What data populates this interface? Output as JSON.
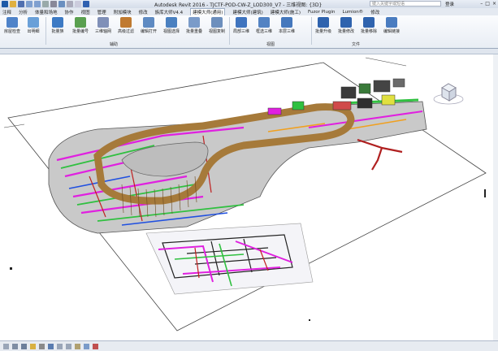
{
  "window": {
    "title": "Autodesk Revit 2016 -   TJCTF-POD-CW-Z_LOD300_V7 - 三维视图: {3D}",
    "search_placeholder": "键入关键字或短语",
    "login": "登录"
  },
  "tabs": [
    "注释",
    "分析",
    "体量和场地",
    "协作",
    "视图",
    "管理",
    "附加模块",
    "修改",
    "族库大师V4.4",
    "建模大师(通用)",
    "建模大师(建筑)",
    "建模大师(施工)",
    "Fuzor Plugin",
    "Lumion®",
    "修改"
  ],
  "ribbon": {
    "buttons": [
      "房屋检查",
      "出明细",
      "批量族",
      "批量编号",
      "三维轴网",
      "高级过滤",
      "编辑打开",
      "视图选择",
      "批量重叠",
      "视图复制",
      "局部三维",
      "框选三维",
      "本层三维",
      "批量升级",
      "批量修改",
      "批量移除",
      "编辑链接"
    ],
    "panels": [
      "辅助",
      "视图",
      "文件"
    ]
  },
  "colors": {
    "accent": "#1e5aa8",
    "magenta": "#e020e0",
    "green": "#30c040",
    "wood": "#a67a3a",
    "red": "#c02020"
  }
}
